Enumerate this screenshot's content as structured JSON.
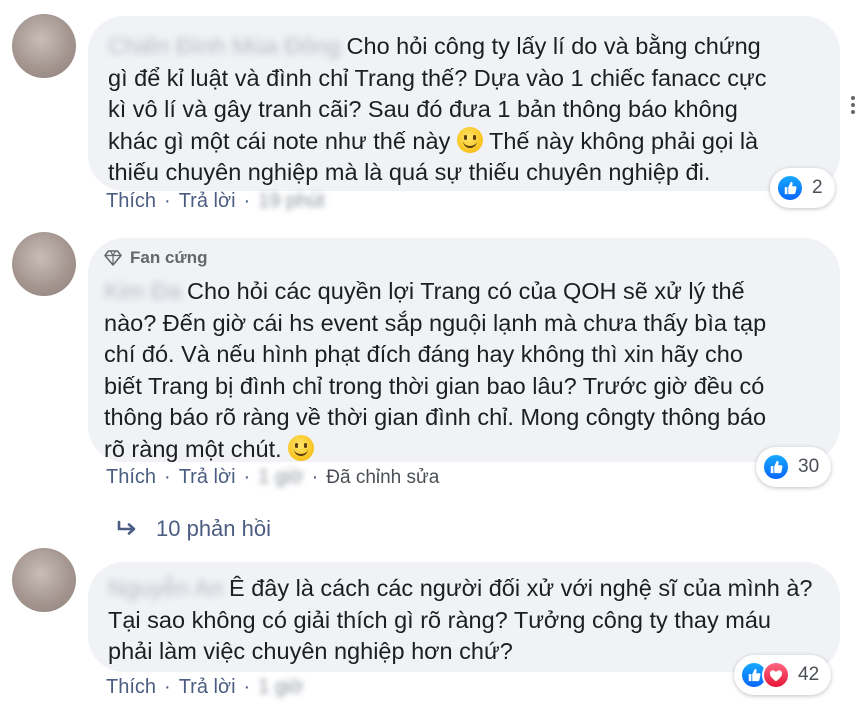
{
  "comments": [
    {
      "author": "Chiến Đình Mùa Đông",
      "text_lines": [
        "Cho hỏi công ty lấy lí do và bằng chứng",
        "gì để kỉ luật và đình chỉ Trang thế? Dựa vào 1 chiếc fanacc cực",
        "kì vô lí và gây tranh cãi? Sau đó đưa 1 bản thông báo không",
        "khác gì một cái note như thế này",
        "Thế này không phải gọi là",
        "thiếu chuyên nghiệp mà là quá sự thiếu chuyên nghiệp đi."
      ],
      "like_label": "Thích",
      "reply_label": "Trả lời",
      "time": "19 phút",
      "reaction_count": "2"
    },
    {
      "badge": "Fan cứng",
      "author": "Kim Đa",
      "text_lines": [
        "Cho hỏi các quyền lợi Trang có của QOH sẽ xử lý thế",
        "nào? Đến giờ cái hs event sắp nguội lạnh mà chưa thấy bìa tạp",
        "chí đó. Và nếu hình phạt đích đáng hay không thì xin hãy cho",
        "biết Trang bị đình chỉ trong thời gian bao lâu? Trước giờ đều có",
        "thông báo rõ ràng về thời gian đình chỉ. Mong côngty thông báo",
        "rõ ràng một chút."
      ],
      "like_label": "Thích",
      "reply_label": "Trả lời",
      "time": "1 giờ",
      "edited_label": "Đã chỉnh sửa",
      "reaction_count": "30",
      "replies_label": "10 phản hồi"
    },
    {
      "author": "Nguyễn An",
      "text_lines": [
        "Ê đây là cách các người đối xử với nghệ sĩ của mình à?",
        "Tại sao không có giải thích gì rõ ràng? Tưởng công ty thay máu",
        "phải làm việc chuyên nghiệp hơn chứ?"
      ],
      "like_label": "Thích",
      "reply_label": "Trả lời",
      "time": "1 giờ",
      "reaction_count": "42"
    }
  ],
  "colors": {
    "bubble": "#f0f2f5",
    "link": "#4b5d82",
    "like": "#0866ff",
    "love": "#e61739"
  }
}
